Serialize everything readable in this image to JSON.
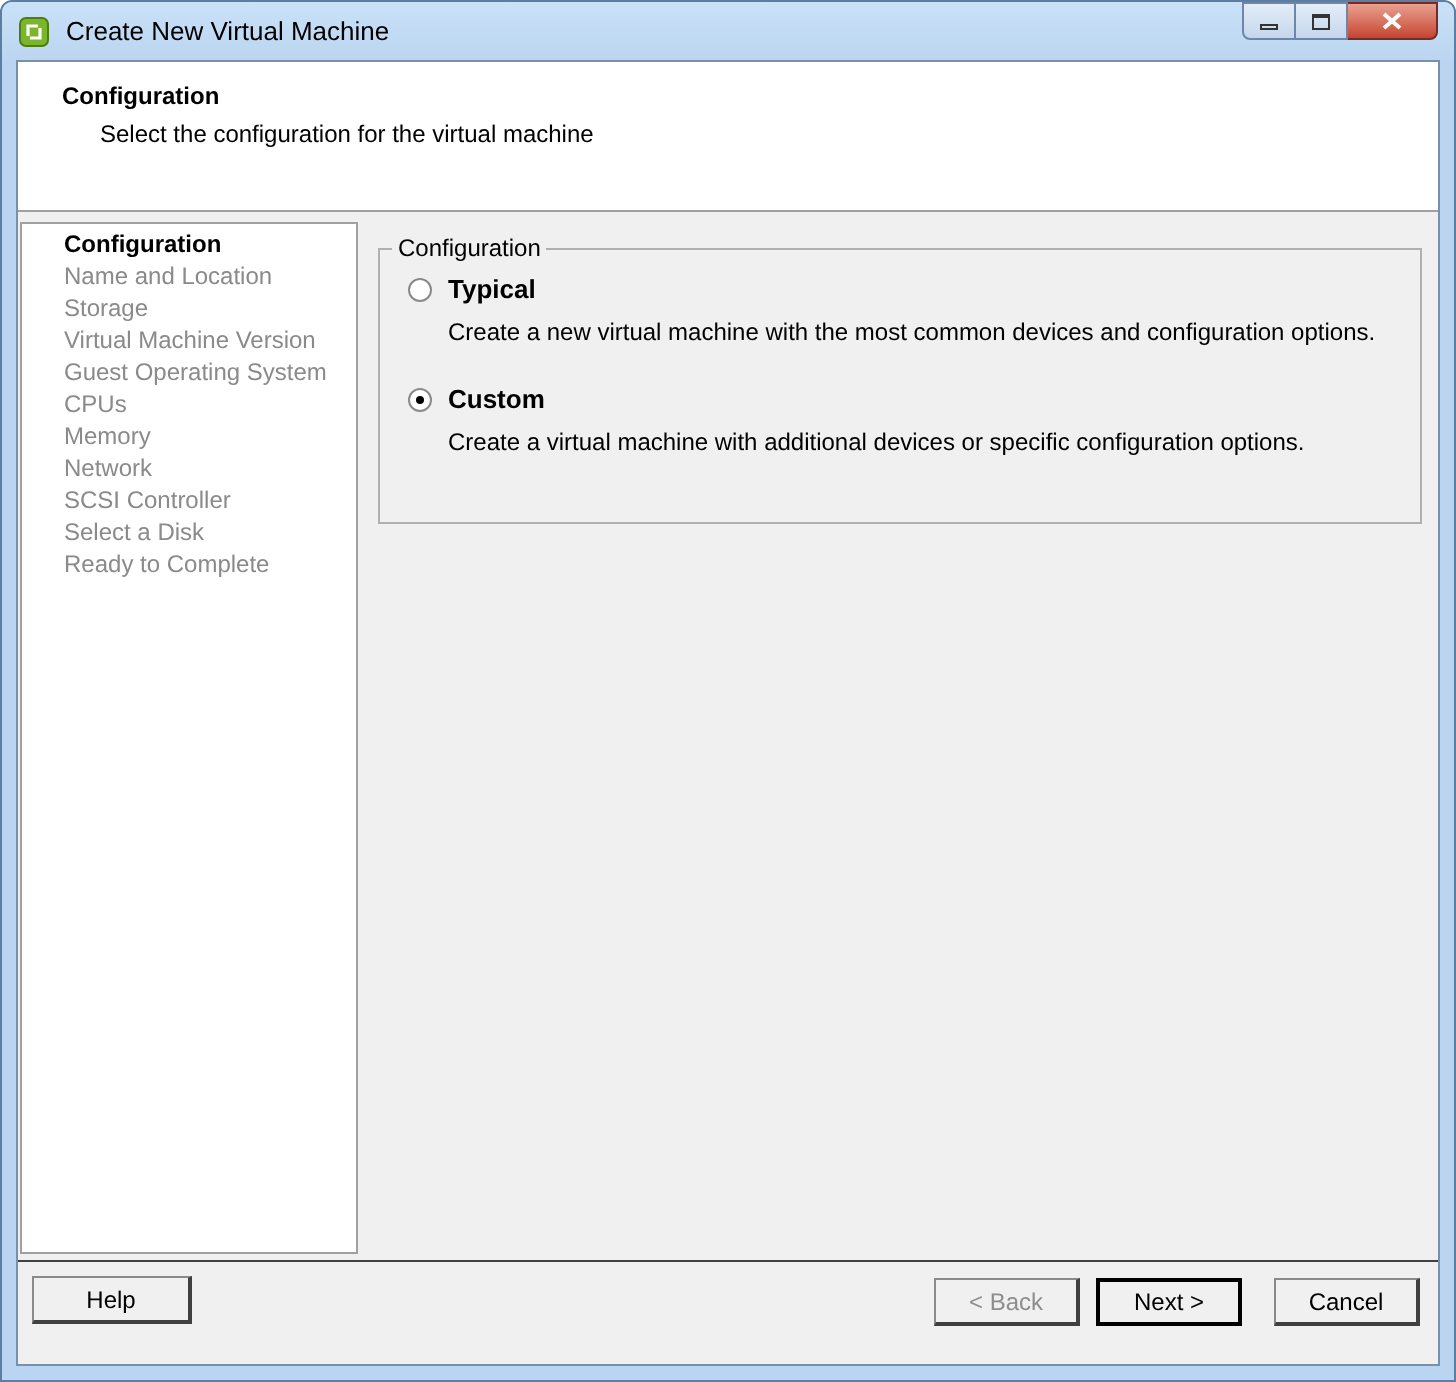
{
  "window": {
    "title": "Create New Virtual Machine"
  },
  "header": {
    "title": "Configuration",
    "subtitle": "Select the configuration for the virtual machine"
  },
  "steps": [
    {
      "label": "Configuration",
      "selected": true
    },
    {
      "label": "Name and Location",
      "selected": false
    },
    {
      "label": "Storage",
      "selected": false
    },
    {
      "label": "Virtual Machine Version",
      "selected": false
    },
    {
      "label": "Guest Operating System",
      "selected": false
    },
    {
      "label": "CPUs",
      "selected": false
    },
    {
      "label": "Memory",
      "selected": false
    },
    {
      "label": "Network",
      "selected": false
    },
    {
      "label": "SCSI Controller",
      "selected": false
    },
    {
      "label": "Select a Disk",
      "selected": false
    },
    {
      "label": "Ready to Complete",
      "selected": false
    }
  ],
  "group": {
    "title": "Configuration",
    "options": [
      {
        "label": "Typical",
        "description": "Create a new virtual machine with the most common devices and configuration options.",
        "selected": false
      },
      {
        "label": "Custom",
        "description": "Create a virtual machine with additional devices or specific configuration options.",
        "selected": true
      }
    ]
  },
  "help_button": {
    "label": "Help",
    "disabled": false,
    "default": false
  },
  "nav_buttons": [
    {
      "label": "< Back",
      "disabled": true,
      "default": false
    },
    {
      "label": "Next >",
      "disabled": false,
      "default": true
    },
    {
      "label": "Cancel",
      "disabled": false,
      "default": false
    }
  ]
}
